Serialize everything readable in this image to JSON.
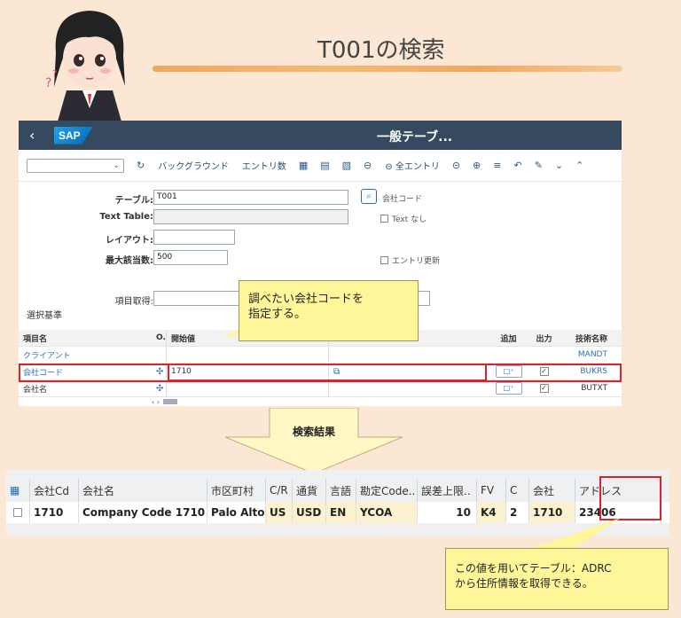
{
  "page": {
    "title": "T001の検索"
  },
  "sap": {
    "logo": "SAP",
    "back": "‹",
    "window_title": "一般テーブ...",
    "toolbar": {
      "background": "バックグラウンド",
      "entry_count": "エントリ数",
      "all_entries": "全エントリ"
    },
    "form": {
      "table_label": "テーブル:",
      "table_value": "T001",
      "text_table_label": "Text Table:",
      "layout_label": "レイアウト:",
      "max_hits_label": "最大該当数:",
      "max_hits_value": "500",
      "company_code_button": "会社コード",
      "text_none": "Text なし",
      "entry_update": "エントリ更新",
      "fetch_items_label": "項目取得:"
    },
    "section_title": "選択基準",
    "sel_table": {
      "headers": {
        "field_name": "項目名",
        "op": "O..",
        "from": "開始値",
        "add": "追加",
        "output": "出力",
        "tech_name": "技術名称"
      },
      "rows": [
        {
          "name": "クライアント",
          "from": "",
          "tech": "MANDT"
        },
        {
          "name": "会社コード",
          "from": "1710",
          "tech": "BUKRS"
        },
        {
          "name": "会社名",
          "from": "",
          "tech": "BUTXT"
        }
      ]
    }
  },
  "callout1": {
    "line1": "調べたい会社コードを",
    "line2": "指定する。"
  },
  "arrow_label": "検索結果",
  "results": {
    "headers": [
      "会社Cd",
      "会社名",
      "市区町村",
      "C/R",
      "通貨",
      "言語",
      "勘定Code..",
      "誤差上限..",
      "FV",
      "C",
      "会社",
      "アドレス"
    ],
    "row": [
      "1710",
      "Company Code 1710",
      "Palo Alto",
      "US",
      "USD",
      "EN",
      "YCOA",
      "10",
      "K4",
      "2",
      "1710",
      "23406"
    ]
  },
  "callout2": {
    "line1": "この値を用いてテーブル：ADRC",
    "line2": "から住所情報を取得できる。"
  },
  "colors": {
    "shellbar": "#354a5f",
    "highlight": "#d9242b",
    "callout": "#fff69a",
    "background": "#fbe7d4"
  }
}
